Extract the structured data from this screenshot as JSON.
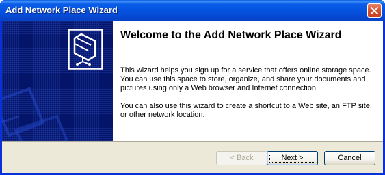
{
  "window": {
    "title": "Add Network Place Wizard",
    "colors": {
      "titlebar": "#0553e0",
      "banner": "#041468",
      "client": "#ece9d8",
      "close_button": "#d9522f"
    }
  },
  "content": {
    "heading": "Welcome to the Add Network Place Wizard",
    "paragraph1": "This wizard helps you sign up for a service that offers online storage space. You can use this space to store, organize, and share your documents and pictures using only a Web browser and Internet connection.",
    "paragraph2": "You can also use this wizard to create a shortcut to a Web site, an FTP site, or other network location."
  },
  "buttons": {
    "back": "< Back",
    "next": "Next >",
    "cancel": "Cancel",
    "back_enabled": false
  },
  "icons": {
    "close": "close-icon",
    "wizard": "network-folder-icon"
  }
}
